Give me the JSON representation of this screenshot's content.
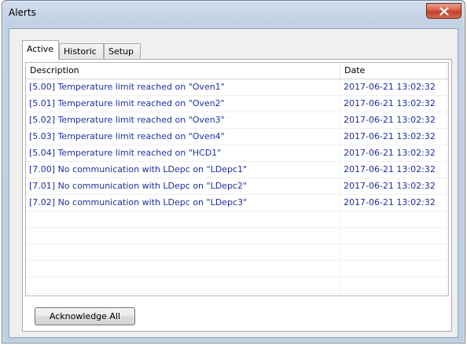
{
  "window": {
    "title": "Alerts"
  },
  "tabs": [
    {
      "label": "Active",
      "active": true
    },
    {
      "label": "Historic",
      "active": false
    },
    {
      "label": "Setup",
      "active": false
    }
  ],
  "table": {
    "columns": {
      "description": "Description",
      "date": "Date"
    },
    "rows": [
      {
        "description": "[5.00] Temperature limit reached on \"Oven1\"",
        "date": "2017-06-21 13:02:32"
      },
      {
        "description": "[5.01] Temperature limit reached on \"Oven2\"",
        "date": "2017-06-21 13:02:32"
      },
      {
        "description": "[5.02] Temperature limit reached on \"Oven3\"",
        "date": "2017-06-21 13:02:32"
      },
      {
        "description": "[5.03] Temperature limit reached on \"Oven4\"",
        "date": "2017-06-21 13:02:32"
      },
      {
        "description": "[5.04] Temperature limit reached on \"HCD1\"",
        "date": "2017-06-21 13:02:32"
      },
      {
        "description": "[7.00] No communication with LDepc on \"LDepc1\"",
        "date": "2017-06-21 13:02:32"
      },
      {
        "description": "[7.01] No communication with LDepc on \"LDepc2\"",
        "date": "2017-06-21 13:02:32"
      },
      {
        "description": "[7.02] No communication with LDepc on \"LDepc3\"",
        "date": "2017-06-21 13:02:32"
      },
      {
        "description": "",
        "date": ""
      },
      {
        "description": "",
        "date": ""
      },
      {
        "description": "",
        "date": ""
      },
      {
        "description": "",
        "date": ""
      },
      {
        "description": "",
        "date": ""
      },
      {
        "description": "",
        "date": ""
      }
    ]
  },
  "buttons": {
    "acknowledge_all": "Acknowledge All"
  },
  "icons": {
    "close": "close-icon"
  },
  "colors": {
    "alert_text": "#1f2e9e",
    "close_button": "#c4412a"
  }
}
